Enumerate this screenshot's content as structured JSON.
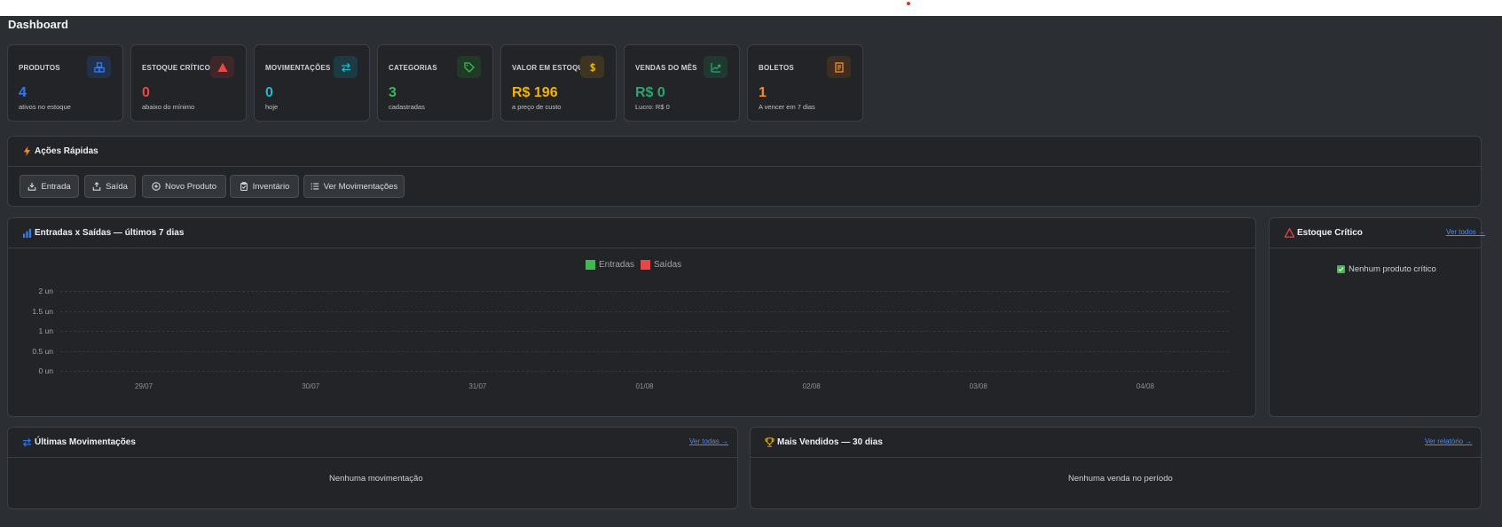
{
  "page": {
    "title": "Dashboard"
  },
  "stats": [
    {
      "label": "PRODUTOS",
      "value": "4",
      "sub": "ativos no estoque",
      "color": "#2f7bf2",
      "icon": "boxes-icon",
      "icon_bg": "#22304a"
    },
    {
      "label": "ESTOQUE CRÍTICO",
      "value": "0",
      "sub": "abaixo do mínimo",
      "color": "#e94646",
      "icon": "warning-icon",
      "icon_bg": "#3e2629"
    },
    {
      "label": "MOVIMENTAÇÕES",
      "value": "0",
      "sub": "hoje",
      "color": "#22b8cf",
      "icon": "arrows-exchange-icon",
      "icon_bg": "#1c3a42"
    },
    {
      "label": "CATEGORIAS",
      "value": "3",
      "sub": "cadastradas",
      "color": "#3fb950",
      "icon": "tag-icon",
      "icon_bg": "#203a27"
    },
    {
      "label": "VALOR EM ESTOQUE",
      "value": "R$ 196",
      "sub": "a preço de custo",
      "color": "#f4b400",
      "icon": "dollar-icon",
      "icon_bg": "#3d3522"
    },
    {
      "label": "VENDAS DO MÊS",
      "value": "R$ 0",
      "sub": "Lucro: R$ 0",
      "color": "#2ea66b",
      "icon": "trending-up-icon",
      "icon_bg": "#1e3a30"
    },
    {
      "label": "BOLETOS",
      "value": "1",
      "sub": "A vencer em 7 dias",
      "color": "#f08c2a",
      "icon": "receipt-icon",
      "icon_bg": "#3e2d21"
    }
  ],
  "quick_actions": {
    "title": "Ações Rápidas",
    "buttons": [
      {
        "label": "Entrada",
        "icon": "download-box-icon"
      },
      {
        "label": "Saída",
        "icon": "upload-box-icon"
      },
      {
        "label": "Novo Produto",
        "icon": "plus-circle-icon"
      },
      {
        "label": "Inventário",
        "icon": "clipboard-check-icon"
      },
      {
        "label": "Ver Movimentações",
        "icon": "list-icon"
      }
    ]
  },
  "chart_panel": {
    "title": "Entradas x Saídas — últimos 7 dias"
  },
  "chart_data": {
    "type": "bar",
    "categories": [
      "29/07",
      "30/07",
      "31/07",
      "01/08",
      "02/08",
      "03/08",
      "04/08"
    ],
    "series": [
      {
        "name": "Entradas",
        "values": [
          0,
          0,
          0,
          0,
          0,
          0,
          0
        ],
        "color": "#3fb950"
      },
      {
        "name": "Saídas",
        "values": [
          0,
          0,
          0,
          0,
          0,
          0,
          0
        ],
        "color": "#e94646"
      }
    ],
    "ytick_labels": [
      "2 un",
      "1.5 un",
      "1 un",
      "0.5 un",
      "0 un"
    ],
    "ylim": [
      0,
      2
    ],
    "legend": "top-center",
    "grid": true
  },
  "critical_stock": {
    "title": "Estoque Crítico",
    "link": "Ver todos →",
    "empty": "Nenhum produto crítico"
  },
  "last_movements": {
    "title": "Últimas Movimentações",
    "link": "Ver todas →",
    "empty": "Nenhuma movimentação"
  },
  "top_sellers": {
    "title": "Mais Vendidos — 30 dias",
    "link": "Ver relatório →",
    "empty": "Nenhuma venda no período"
  },
  "colors": {
    "background": "#2b2e32",
    "card": "#222428",
    "border": "#3c4046",
    "link": "#4d8cf5",
    "accent_warning": "#e94646"
  }
}
